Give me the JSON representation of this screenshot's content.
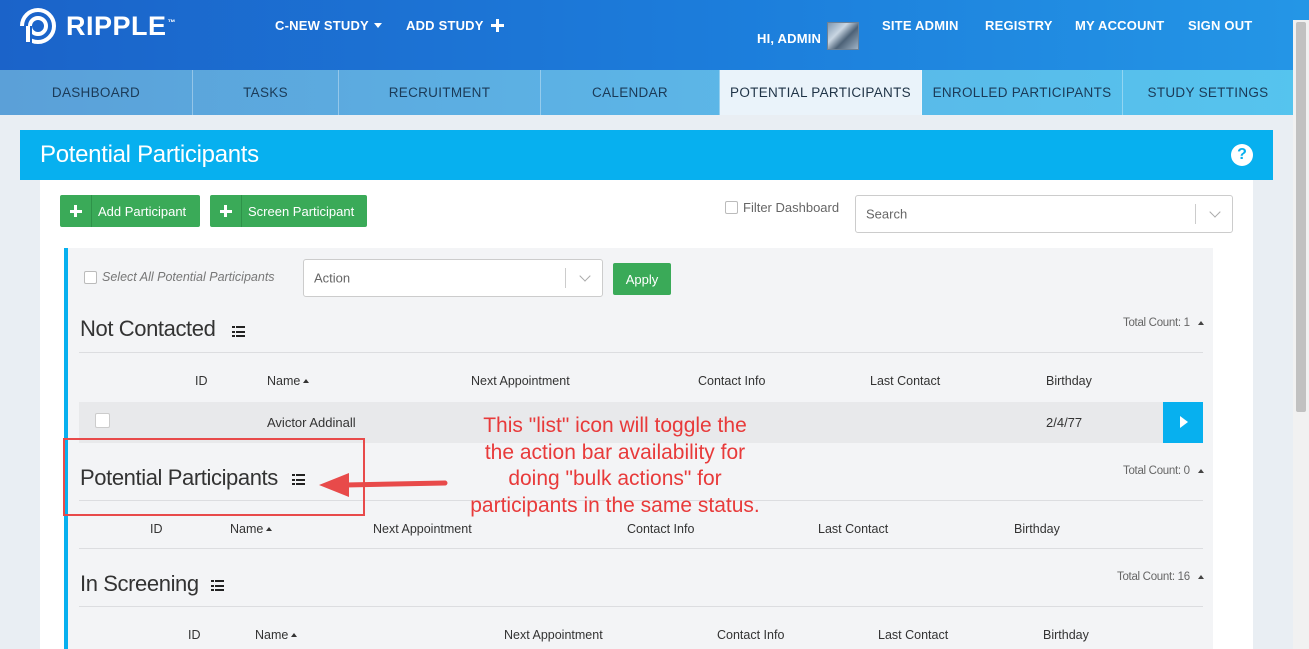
{
  "header": {
    "logo_text": "RIPPLE",
    "logo_tm": "™",
    "study_select_label": "C-NEW STUDY",
    "add_study_label": "ADD STUDY",
    "greeting": "HI, ADMIN",
    "links": [
      "SITE ADMIN",
      "REGISTRY",
      "MY ACCOUNT",
      "SIGN OUT"
    ]
  },
  "tabs": [
    {
      "label": "DASHBOARD",
      "active": false
    },
    {
      "label": "TASKS",
      "active": false
    },
    {
      "label": "RECRUITMENT",
      "active": false
    },
    {
      "label": "CALENDAR",
      "active": false
    },
    {
      "label": "POTENTIAL PARTICIPANTS",
      "active": true
    },
    {
      "label": "ENROLLED PARTICIPANTS",
      "active": false
    },
    {
      "label": "STUDY SETTINGS",
      "active": false
    }
  ],
  "page": {
    "title": "Potential Participants",
    "help_glyph": "?",
    "add_participant_label": "Add Participant",
    "screen_participant_label": "Screen Participant",
    "filter_dashboard_label": "Filter Dashboard",
    "search_placeholder": "Search",
    "select_all_label": "Select All Potential Participants",
    "action_placeholder": "Action",
    "apply_label": "Apply"
  },
  "columns": {
    "id": "ID",
    "name": "Name",
    "next_appointment": "Next Appointment",
    "contact_info": "Contact Info",
    "last_contact": "Last Contact",
    "birthday": "Birthday"
  },
  "sections": [
    {
      "title": "Not Contacted",
      "total": "Total Count: 1",
      "rows": [
        {
          "id": "",
          "name": "Avictor Addinall",
          "next_appointment": "",
          "contact_info": "",
          "last_contact": "",
          "birthday": "2/4/77"
        }
      ]
    },
    {
      "title": "Potential Participants",
      "total": "Total Count: 0",
      "rows": []
    },
    {
      "title": "In Screening",
      "total": "Total Count: 16",
      "rows": []
    }
  ],
  "annotation": {
    "lines": [
      "This \"list\" icon will toggle the",
      "the action bar availability for",
      "doing \"bulk actions\" for",
      "participants in the same status."
    ],
    "color": "#e83a3a"
  },
  "colors": {
    "accent_blue": "#07b0ef",
    "green": "#3aaa58",
    "header_blue": "#1c7ddb"
  }
}
